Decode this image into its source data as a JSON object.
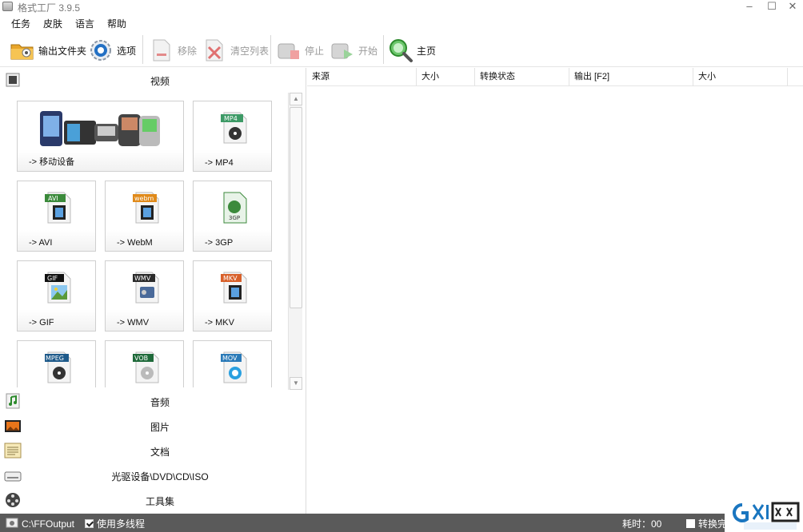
{
  "window": {
    "title": "格式工厂 3.9.5"
  },
  "menu": [
    "任务",
    "皮肤",
    "语言",
    "帮助"
  ],
  "toolbar": {
    "output_folder": "输出文件夹",
    "options": "选项",
    "remove": "移除",
    "clear_list": "清空列表",
    "stop": "停止",
    "start": "开始",
    "home": "主页"
  },
  "left": {
    "video_header": "视频",
    "tiles": [
      {
        "label": "-> 移动设备",
        "badge": ""
      },
      {
        "label": "-> MP4",
        "badge": "MP4"
      },
      {
        "label": "-> AVI",
        "badge": "AVI"
      },
      {
        "label": "-> WebM",
        "badge": "webm"
      },
      {
        "label": "-> 3GP",
        "badge": "3GP"
      },
      {
        "label": "-> GIF",
        "badge": "GIF"
      },
      {
        "label": "-> WMV",
        "badge": "WMV"
      },
      {
        "label": "-> MKV",
        "badge": "MKV"
      },
      {
        "label": "",
        "badge": "MPEG"
      },
      {
        "label": "",
        "badge": "VOB"
      },
      {
        "label": "",
        "badge": "MOV"
      }
    ],
    "categories": [
      {
        "label": "音频"
      },
      {
        "label": "图片"
      },
      {
        "label": "文档"
      },
      {
        "label": "光驱设备\\DVD\\CD\\ISO"
      },
      {
        "label": "工具集"
      }
    ]
  },
  "table": {
    "columns": [
      "来源",
      "大小",
      "转换状态",
      "输出 [F2]",
      "大小"
    ]
  },
  "status": {
    "output_path": "C:\\FFOutput",
    "multithread": "使用多线程",
    "elapsed": "耗时：00",
    "after_convert": "转换完"
  },
  "colors": {
    "statusbar": "#5a5a5a",
    "watermark_blue": "#1a76c0"
  }
}
